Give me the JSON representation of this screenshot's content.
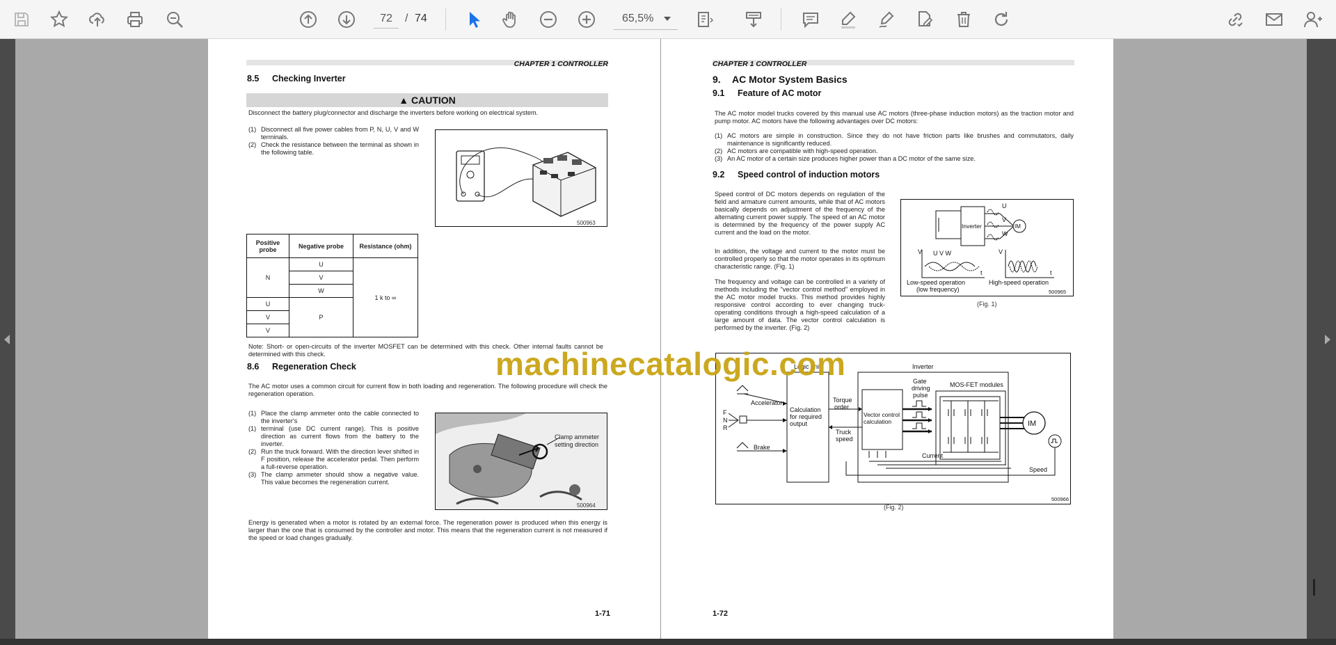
{
  "toolbar": {
    "current_page": "72",
    "page_separator": "/",
    "total_pages": "74",
    "zoom": "65,5%",
    "icons": [
      "save-icon",
      "bookmark-star-icon",
      "upload-icon",
      "print-icon",
      "zoom-search-icon",
      "page-up-icon",
      "page-down-icon",
      "pointer-icon",
      "hand-icon",
      "zoom-out-icon",
      "zoom-in-icon",
      "fit-page-icon",
      "read-mode-icon",
      "comment-icon",
      "highlight-icon",
      "draw-icon",
      "edit-icon",
      "delete-icon",
      "redo-icon",
      "share-link-icon",
      "email-icon",
      "add-user-icon"
    ]
  },
  "watermark": "machinecatalogic.com",
  "left_page": {
    "chapter": "CHAPTER 1 CONTROLLER",
    "s85": {
      "num": "8.5",
      "title": "Checking Inverter"
    },
    "caution": "CAUTION",
    "caution_text": "Disconnect the battery plug/connector and discharge the inverters before working on electrical system.",
    "steps_a": [
      {
        "n": "(1)",
        "t": "Disconnect all five power cables from P, N, U, V and W terminals."
      },
      {
        "n": "(2)",
        "t": "Check the resistance between the terminal as shown in the following table."
      }
    ],
    "fig1_id": "500963",
    "table": {
      "headers": [
        "Positive probe",
        "Negative probe",
        "Resistance (ohm)"
      ],
      "pos_n": "N",
      "neg_list": [
        "U",
        "V",
        "W"
      ],
      "pos_list": [
        "U",
        "V",
        "V"
      ],
      "neg_p": "P",
      "resistance": "1 k to ∞"
    },
    "note": "Note: Short- or open-circuits of the inverter MOSFET can be determined with this check. Other internal faults cannot be determined with this check.",
    "s86": {
      "num": "8.6",
      "title": "Regeneration Check"
    },
    "regen_intro": "The AC motor uses a common circuit for current flow in both loading and regeneration. The following procedure will check the regeneration operation.",
    "steps_b": [
      {
        "n": "(1)",
        "t": "Place the clamp ammeter onto the cable connected to the inverter's"
      },
      {
        "n": "(1)",
        "t": "terminal (use DC current range). This is positive direction as current flows from the battery to the inverter."
      },
      {
        "n": "(2)",
        "t": "Run the truck forward. With the direction lever shifted in F position, release the accelerator pedal. Then perform a full-reverse operation."
      },
      {
        "n": "(3)",
        "t": "The clamp ammeter should show a negative value. This value becomes the regeneration current."
      }
    ],
    "fig2_label": "Clamp ammeter setting direction",
    "fig2_id": "500964",
    "energy_text": "Energy is generated when a motor is rotated by an external force. The regeneration power is produced when this energy is larger than the one that is consumed by the controller and motor. This means that the regeneration current is not measured if the speed or load changes gradually.",
    "page_no": "1-71"
  },
  "right_page": {
    "chapter": "CHAPTER 1 CONTROLLER",
    "s9": {
      "num": "9.",
      "title": "AC Motor System Basics"
    },
    "s91": {
      "num": "9.1",
      "title": "Feature of AC motor"
    },
    "intro": "The AC motor model trucks covered by this manual use AC motors (three-phase induction motors) as the traction motor and pump motor. AC motors have the following advantages over DC motors:",
    "adv": [
      {
        "n": "(1)",
        "t": "AC motors are simple in construction. Since they do not have friction parts like brushes and commutators, daily maintenance is significantly reduced."
      },
      {
        "n": "(2)",
        "t": "AC motors are compatible with high-speed operation."
      },
      {
        "n": "(3)",
        "t": "An AC motor of a certain size produces higher power than a DC motor of the same size."
      }
    ],
    "s92": {
      "num": "9.2",
      "title": "Speed control of induction motors"
    },
    "p1": "Speed control of DC motors depends on regulation of the field and armature current amounts, while that of AC motors basically depends on adjustment of the frequency of the alternating current power supply. The speed of an AC motor is determined by the frequency of the power supply AC current and the load on the motor.",
    "p2": "In addition, the voltage and current to the motor must be controlled properly so that the motor operates in its optimum characteristic range. (Fig. 1)",
    "p3": "The frequency and voltage can be controlled in a variety of methods including the \"vector control method\" employed in the AC motor model trucks. This method provides highly responsive control according to ever changing truck-operating conditions through a high-speed calculation of a large amount of data. The vector control calculation is performed by the inverter. (Fig. 2)",
    "fig1": {
      "inverter": "Inverter",
      "im": "IM",
      "u": "U",
      "v": "V",
      "w": "W",
      "low": "Low-speed operation",
      "low2": "(low frequency)",
      "high": "High-speed operation",
      "uvw": "U  V  W",
      "t": "t",
      "vaxis": "V",
      "id": "500965",
      "caption": "(Fig. 1)"
    },
    "fig2": {
      "logic": "Logic unit",
      "inverter": "Inverter",
      "gate": "Gate",
      "driving": "driving",
      "pulse": "pulse",
      "mosfet": "MOS-FET modules",
      "accel": "Accelerator",
      "calc1": "Calculation",
      "calc2": "for required",
      "calc3": "output",
      "torque1": "Torque",
      "torque2": "order",
      "vec1": "Vector control",
      "vec2": "calculation",
      "f": "F",
      "n": "N",
      "r": "R",
      "brake": "Brake",
      "truck1": "Truck",
      "truck2": "speed",
      "current": "Current",
      "speed": "Speed",
      "im": "IM",
      "id": "500966",
      "caption": "(Fig. 2)"
    },
    "page_no": "1-72"
  },
  "colors": {
    "toolbar_bg": "#f5f5f5",
    "icon": "#7a7a7a",
    "active_icon": "#1a73e8",
    "watermark": "#c9a414",
    "page_bg": "#a9a9a9"
  }
}
